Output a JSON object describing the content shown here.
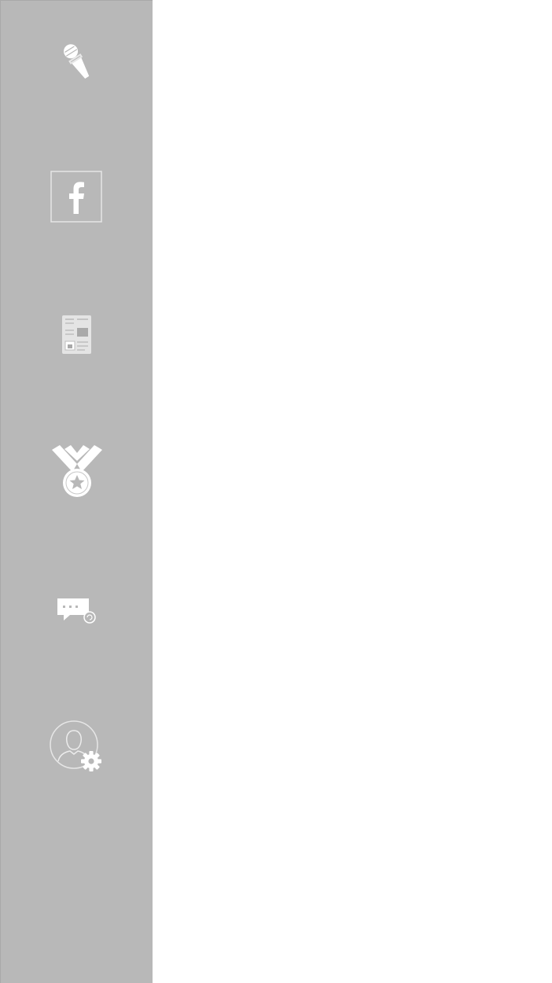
{
  "sidebar": {
    "background": "#b8b8b8",
    "icon_color": "#ffffff",
    "items": [
      {
        "icon": "microphone-icon"
      },
      {
        "icon": "facebook-icon"
      },
      {
        "icon": "newspaper-icon"
      },
      {
        "icon": "medal-icon"
      },
      {
        "icon": "chat-icon"
      },
      {
        "icon": "user-settings-icon"
      }
    ]
  }
}
